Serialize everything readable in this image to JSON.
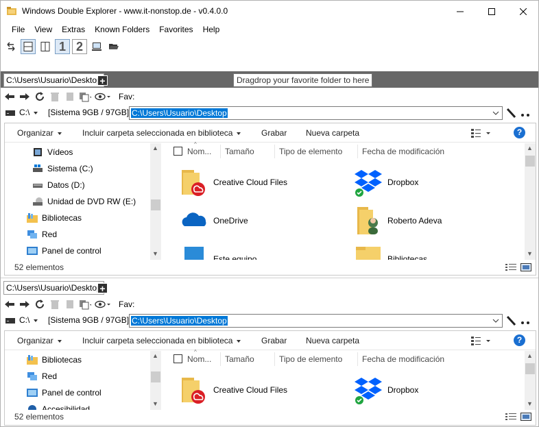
{
  "window": {
    "title": "Windows Double Explorer - www.it-nonstop.de - v0.4.0.0",
    "minimize_label": "—",
    "maximize_label": "☐",
    "close_label": "✕"
  },
  "menu": [
    "File",
    "View",
    "Extras",
    "Known Folders",
    "Favorites",
    "Help"
  ],
  "toolbar": {
    "layout_1_label": "1",
    "layout_2_label": "2"
  },
  "tooltip": "Dragdrop your favorite folder to here",
  "colors": {
    "accent": "#0078d7",
    "strip": "#676767",
    "dropbox": "#0061fe",
    "cc": "#da1f26",
    "onedrive": "#0a64c2",
    "folder": "#f5c95a"
  },
  "panes": [
    {
      "tab_label": "C:\\Users\\Usuario\\Desktop",
      "add_tab_label": "+",
      "fav_label": "Fav:",
      "drive": "C:\\",
      "drive_info": "[Sistema 9GB / 97GB]",
      "path": "C:\\Users\\Usuario\\Desktop",
      "commands": [
        "Organizar",
        "Incluir carpeta seleccionada en biblioteca",
        "Grabar",
        "Nueva carpeta"
      ],
      "help_label": "?",
      "tree": [
        {
          "label": "Vídeos",
          "icon": "video-folder-icon"
        },
        {
          "label": "Sistema (C:)",
          "icon": "system-drive-icon"
        },
        {
          "label": "Datos (D:)",
          "icon": "drive-icon"
        },
        {
          "label": "Unidad de DVD RW (E:)",
          "icon": "dvd-drive-icon"
        },
        {
          "label": "Bibliotecas",
          "icon": "library-icon"
        },
        {
          "label": "Red",
          "icon": "network-icon"
        },
        {
          "label": "Panel de control",
          "icon": "control-panel-icon"
        }
      ],
      "columns": [
        "Nom...",
        "Tamaño",
        "Tipo de elemento",
        "Fecha de modificación"
      ],
      "items": [
        {
          "label": "Creative Cloud Files",
          "icon": "creative-cloud-folder-icon"
        },
        {
          "label": "Dropbox",
          "icon": "dropbox-icon"
        },
        {
          "label": "OneDrive",
          "icon": "onedrive-icon"
        },
        {
          "label": "Roberto Adeva",
          "icon": "user-folder-icon"
        },
        {
          "label": "Este equipo",
          "icon": "computer-icon"
        },
        {
          "label": "Bibliotecas",
          "icon": "library-folder-icon"
        }
      ],
      "status": "52 elementos"
    },
    {
      "tab_label": "C:\\Users\\Usuario\\Desktop",
      "add_tab_label": "+",
      "fav_label": "Fav:",
      "drive": "C:\\",
      "drive_info": "[Sistema 9GB / 97GB]",
      "path": "C:\\Users\\Usuario\\Desktop",
      "commands": [
        "Organizar",
        "Incluir carpeta seleccionada en biblioteca",
        "Grabar",
        "Nueva carpeta"
      ],
      "help_label": "?",
      "tree": [
        {
          "label": "Bibliotecas",
          "icon": "library-icon"
        },
        {
          "label": "Red",
          "icon": "network-icon"
        },
        {
          "label": "Panel de control",
          "icon": "control-panel-icon"
        },
        {
          "label": "Accesibilidad",
          "icon": "accessibility-icon"
        }
      ],
      "columns": [
        "Nom...",
        "Tamaño",
        "Tipo de elemento",
        "Fecha de modificación"
      ],
      "items": [
        {
          "label": "Creative Cloud Files",
          "icon": "creative-cloud-folder-icon"
        },
        {
          "label": "Dropbox",
          "icon": "dropbox-icon"
        }
      ],
      "status": "52 elementos"
    }
  ]
}
